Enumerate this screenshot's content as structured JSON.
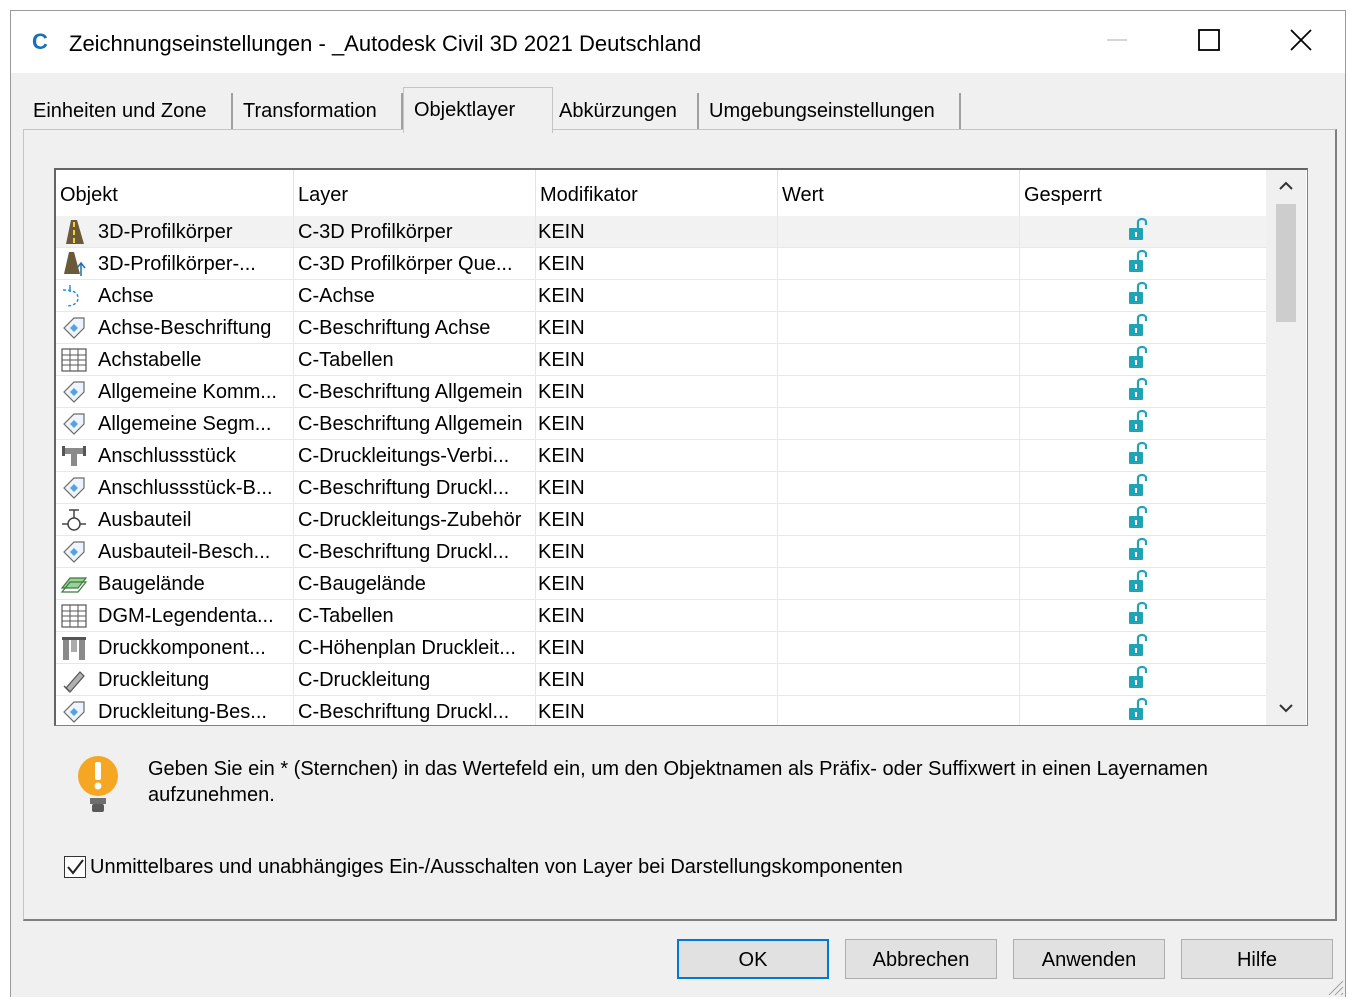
{
  "window": {
    "title": "Zeichnungseinstellungen - _Autodesk Civil 3D 2021 Deutschland",
    "app_icon_letter": "C",
    "accent_color": "#0078d7"
  },
  "tabs": [
    {
      "label": "Einheiten und Zone",
      "active": false
    },
    {
      "label": "Transformation",
      "active": false
    },
    {
      "label": "Objektlayer",
      "active": true
    },
    {
      "label": "Abkürzungen",
      "active": false
    },
    {
      "label": "Umgebungseinstellungen",
      "active": false
    }
  ],
  "grid": {
    "columns": [
      "Objekt",
      "Layer",
      "Modifikator",
      "Wert",
      "Gesperrt"
    ],
    "rows": [
      {
        "objekt": "3D-Profilkörper",
        "layer": "C-3D Profilkörper",
        "modifikator": "KEIN",
        "wert": "",
        "icon": "road-icon"
      },
      {
        "objekt": "3D-Profilkörper-...",
        "layer": "C-3D Profilkörper Que...",
        "modifikator": "KEIN",
        "wert": "",
        "icon": "road-section-icon"
      },
      {
        "objekt": "Achse",
        "layer": "C-Achse",
        "modifikator": "KEIN",
        "wert": "",
        "icon": "alignment-icon"
      },
      {
        "objekt": "Achse-Beschriftung",
        "layer": "C-Beschriftung Achse",
        "modifikator": "KEIN",
        "wert": "",
        "icon": "label-tag-icon"
      },
      {
        "objekt": "Achstabelle",
        "layer": "C-Tabellen",
        "modifikator": "KEIN",
        "wert": "",
        "icon": "table-icon"
      },
      {
        "objekt": "Allgemeine Komm...",
        "layer": "C-Beschriftung Allgemein",
        "modifikator": "KEIN",
        "wert": "",
        "icon": "label-tag-icon"
      },
      {
        "objekt": "Allgemeine Segm...",
        "layer": "C-Beschriftung Allgemein",
        "modifikator": "KEIN",
        "wert": "",
        "icon": "label-tag-icon"
      },
      {
        "objekt": "Anschlussstück",
        "layer": "C-Druckleitungs-Verbi...",
        "modifikator": "KEIN",
        "wert": "",
        "icon": "fitting-icon"
      },
      {
        "objekt": "Anschlussstück-B...",
        "layer": "C-Beschriftung Druckl...",
        "modifikator": "KEIN",
        "wert": "",
        "icon": "label-tag-icon"
      },
      {
        "objekt": "Ausbauteil",
        "layer": "C-Druckleitungs-Zubehör",
        "modifikator": "KEIN",
        "wert": "",
        "icon": "valve-icon"
      },
      {
        "objekt": "Ausbauteil-Besch...",
        "layer": "C-Beschriftung Druckl...",
        "modifikator": "KEIN",
        "wert": "",
        "icon": "label-tag-icon"
      },
      {
        "objekt": "Baugelände",
        "layer": "C-Baugelände",
        "modifikator": "KEIN",
        "wert": "",
        "icon": "site-icon"
      },
      {
        "objekt": "DGM-Legendenta...",
        "layer": "C-Tabellen",
        "modifikator": "KEIN",
        "wert": "",
        "icon": "table-icon"
      },
      {
        "objekt": "Druckkomponent...",
        "layer": "C-Höhenplan Druckleit...",
        "modifikator": "KEIN",
        "wert": "",
        "icon": "pressure-network-icon"
      },
      {
        "objekt": "Druckleitung",
        "layer": "C-Druckleitung",
        "modifikator": "KEIN",
        "wert": "",
        "icon": "pipe-icon"
      },
      {
        "objekt": "Druckleitung-Bes...",
        "layer": "C-Beschriftung Druckl...",
        "modifikator": "KEIN",
        "wert": "",
        "icon": "label-tag-icon"
      }
    ]
  },
  "hint": {
    "text": "Geben Sie ein * (Sternchen) in das Wertefeld ein, um den Objektnamen als Präfix- oder Suffixwert in einen Layernamen aufzunehmen."
  },
  "checkbox": {
    "label": "Unmittelbares und unabhängiges Ein-/Ausschalten von Layer bei Darstellungskomponenten",
    "checked": true
  },
  "buttons": {
    "ok": "OK",
    "cancel": "Abbrechen",
    "apply": "Anwenden",
    "help": "Hilfe"
  }
}
